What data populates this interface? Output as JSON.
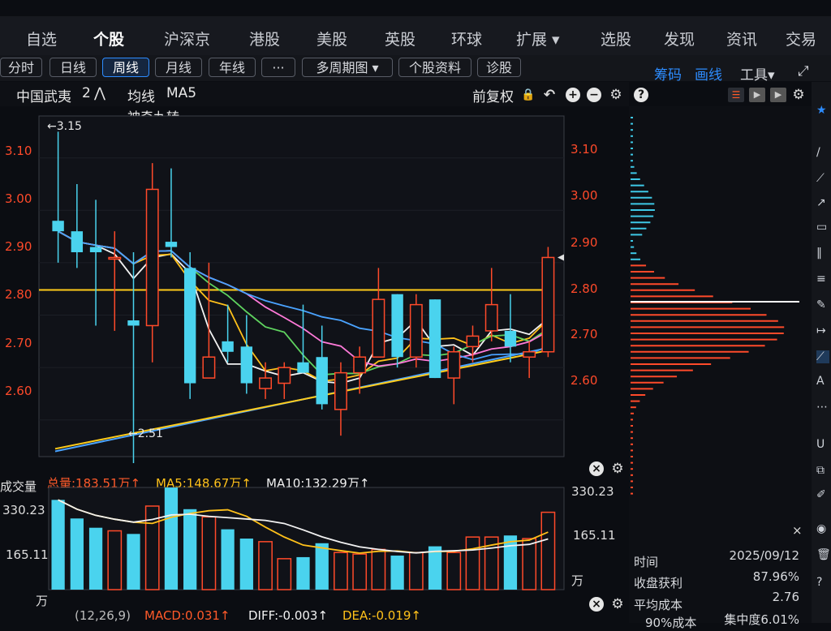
{
  "top_nav": {
    "items": [
      "自选",
      "个股",
      "沪深京",
      "港股",
      "美股",
      "英股",
      "环球",
      "扩展 ▾",
      "选股",
      "发现",
      "资讯",
      "交易"
    ],
    "active": "个股"
  },
  "period_bar": {
    "buttons": [
      "分时",
      "日线",
      "周线",
      "月线",
      "年线",
      "···",
      "多周期图 ▾",
      "个股资料",
      "诊股"
    ],
    "active": "周线",
    "right_links": {
      "chips": "筹码",
      "draw": "画线",
      "tools": "工具▾"
    }
  },
  "info_line": {
    "stock_name": "中国武夷",
    "count": "2",
    "arrow": "⋀",
    "ma_label": "均线",
    "ma_name": "MA5",
    "indicator": "神奇九转",
    "adjust": "前复权",
    "help": "?"
  },
  "price_axis": {
    "left_labels": [
      "3.10",
      "3.00",
      "2.90",
      "2.80",
      "2.70",
      "2.60"
    ],
    "right_labels": [
      "3.10",
      "3.00",
      "2.90",
      "2.80",
      "2.70",
      "2.60"
    ],
    "high_marker": "←3.15",
    "low_marker": "←2.51"
  },
  "volume_header": {
    "title": "成交量",
    "total": "总量:183.51万↑",
    "ma5": "MA5:148.67万↑",
    "ma10": "MA10:132.29万↑",
    "axis": [
      "330.23",
      "165.11",
      "万"
    ]
  },
  "macd_header": {
    "macd": "MACD:0.031↑",
    "diff": "DIFF:-0.003↑",
    "dea": "DEA:-0.019↑",
    "partial_left": "(12,26,9)"
  },
  "right_panel": {
    "close": "×",
    "rows": [
      {
        "label": "时间",
        "value": "2025/09/12"
      },
      {
        "label": "收盘获利",
        "value": "87.96%"
      },
      {
        "label": "平均成本",
        "value": "2.76"
      },
      {
        "label": "90%成本",
        "value": "集中度6.01%"
      }
    ]
  },
  "colors": {
    "up": "#ff4a2a",
    "down": "#4ad3ee",
    "accent": "#1b8cff"
  },
  "chart_data": {
    "type": "candlestick",
    "candles": [
      {
        "o": 2.98,
        "h": 3.15,
        "l": 2.9,
        "c": 2.96
      },
      {
        "o": 2.96,
        "h": 3.05,
        "l": 2.89,
        "c": 2.92
      },
      {
        "o": 2.93,
        "h": 3.02,
        "l": 2.78,
        "c": 2.92
      },
      {
        "o": 2.91,
        "h": 2.96,
        "l": 2.77,
        "c": 2.91
      },
      {
        "o": 2.79,
        "h": 2.92,
        "l": 2.51,
        "c": 2.78
      },
      {
        "o": 2.78,
        "h": 3.09,
        "l": 2.71,
        "c": 3.04
      },
      {
        "o": 2.94,
        "h": 3.08,
        "l": 2.91,
        "c": 2.93
      },
      {
        "o": 2.89,
        "h": 2.92,
        "l": 2.64,
        "c": 2.67
      },
      {
        "o": 2.68,
        "h": 2.9,
        "l": 2.68,
        "c": 2.72
      },
      {
        "o": 2.75,
        "h": 2.82,
        "l": 2.71,
        "c": 2.73
      },
      {
        "o": 2.74,
        "h": 2.8,
        "l": 2.65,
        "c": 2.67
      },
      {
        "o": 2.66,
        "h": 2.71,
        "l": 2.64,
        "c": 2.68
      },
      {
        "o": 2.67,
        "h": 2.71,
        "l": 2.64,
        "c": 2.7
      },
      {
        "o": 2.71,
        "h": 2.82,
        "l": 2.69,
        "c": 2.69
      },
      {
        "o": 2.72,
        "h": 2.78,
        "l": 2.62,
        "c": 2.63
      },
      {
        "o": 2.62,
        "h": 2.71,
        "l": 2.57,
        "c": 2.69
      },
      {
        "o": 2.69,
        "h": 2.74,
        "l": 2.65,
        "c": 2.72
      },
      {
        "o": 2.72,
        "h": 2.89,
        "l": 2.72,
        "c": 2.83
      },
      {
        "o": 2.84,
        "h": 2.84,
        "l": 2.7,
        "c": 2.72
      },
      {
        "o": 2.72,
        "h": 2.84,
        "l": 2.7,
        "c": 2.82
      },
      {
        "o": 2.83,
        "h": 2.83,
        "l": 2.68,
        "c": 2.68
      },
      {
        "o": 2.68,
        "h": 2.74,
        "l": 2.63,
        "c": 2.73
      },
      {
        "o": 2.74,
        "h": 2.78,
        "l": 2.71,
        "c": 2.76
      },
      {
        "o": 2.77,
        "h": 2.89,
        "l": 2.75,
        "c": 2.82
      },
      {
        "o": 2.77,
        "h": 2.84,
        "l": 2.71,
        "c": 2.74
      },
      {
        "o": 2.72,
        "h": 2.75,
        "l": 2.68,
        "c": 2.73
      },
      {
        "o": 2.73,
        "h": 2.93,
        "l": 2.72,
        "c": 2.91
      }
    ],
    "volume": [
      290,
      230,
      200,
      190,
      180,
      270,
      330,
      260,
      235,
      195,
      165,
      155,
      100,
      105,
      150,
      120,
      115,
      130,
      110,
      120,
      140,
      120,
      170,
      170,
      175,
      165,
      250
    ],
    "volume_ylim": [
      0,
      330.23
    ],
    "ylim": [
      2.53,
      3.18
    ]
  }
}
